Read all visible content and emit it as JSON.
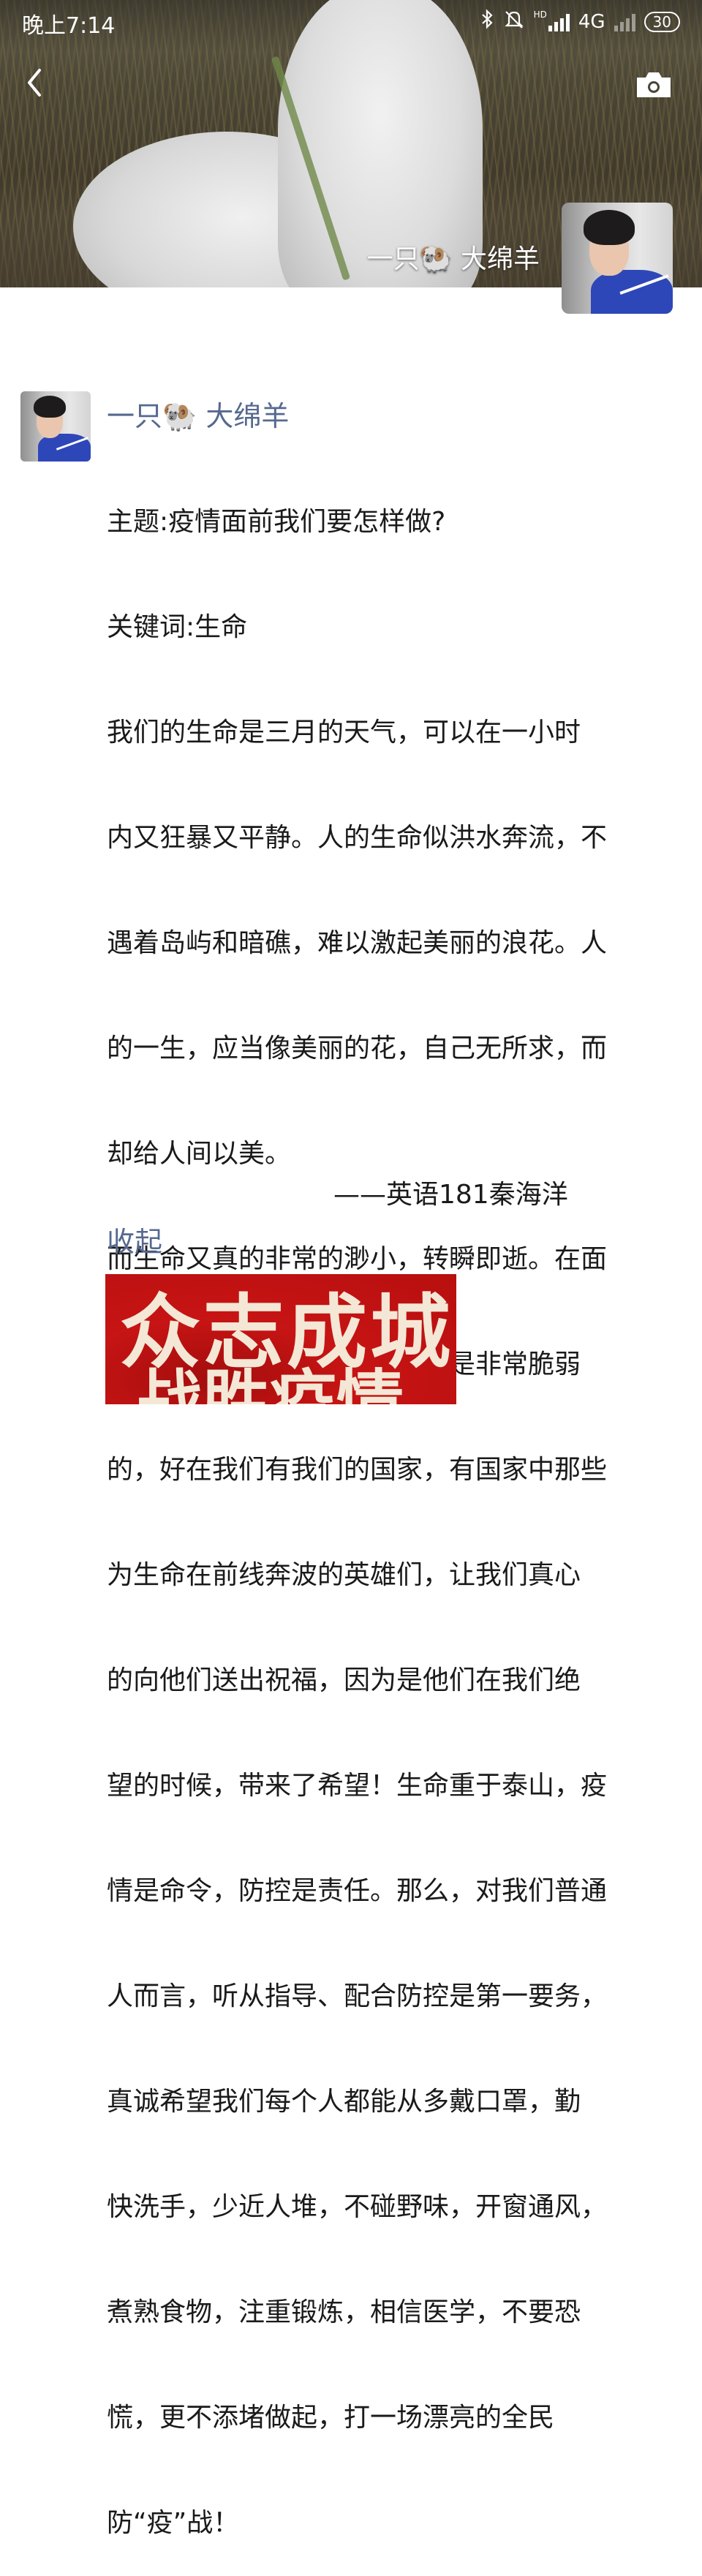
{
  "status_bar": {
    "time": "晚上7:14",
    "network": "4G",
    "hd_label": "HD",
    "battery": "30",
    "icons": [
      "bluetooth-icon",
      "silent-bell-icon",
      "signal-icon",
      "signal-icon-dim",
      "battery-icon"
    ]
  },
  "header": {
    "back_icon": "chevron-left-icon",
    "camera_icon": "camera-icon",
    "cover_name": "一只🐏 大绵羊"
  },
  "post": {
    "author": "一只🐏 大绵羊",
    "lines": [
      "主题:疫情面前我们要怎样做?",
      "关键词:生命",
      "我们的生命是三月的天气，可以在一小时",
      "内又狂暴又平静。人的生命似洪水奔流，不",
      "遇着岛屿和暗礁，难以激起美丽的浪花。人",
      "的一生，应当像美丽的花，自己无所求，而",
      "却给人间以美。",
      "而生命又真的非常的渺小，转瞬即逝。在面",
      "对新型冠状病毒的时候，生命是非常脆弱",
      "的，好在我们有我们的国家，有国家中那些",
      "为生命在前线奔波的英雄们，让我们真心",
      "的向他们送出祝福，因为是他们在我们绝",
      "望的时候，带来了希望！生命重于泰山，疫",
      "情是命令，防控是责任。那么，对我们普通",
      "人而言，听从指导、配合防控是第一要务，",
      "真诚希望我们每个人都能从多戴口罩，勤",
      "快洗手，少近人堆，不碰野味，开窗通风，",
      "煮熟食物，注重锻炼，相信医学，不要恐",
      "慌，更不添堵做起，打一场漂亮的全民",
      "防“疫”战！"
    ],
    "signature": "——英语181秦海洋",
    "collapse_label": "收起",
    "image_text_line1": "众志成城",
    "image_text_line2": "战胜疫情"
  },
  "colors": {
    "link": "#56698f",
    "text": "#1a1a1a",
    "poster_red": "#c71414"
  }
}
